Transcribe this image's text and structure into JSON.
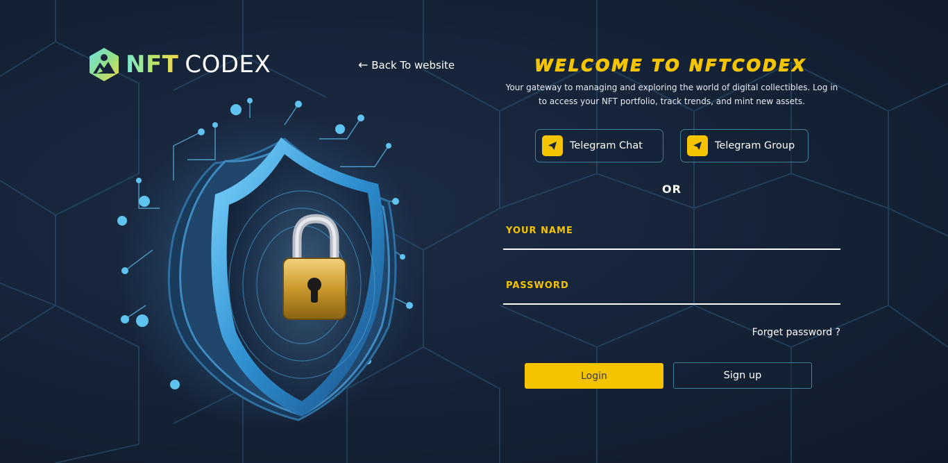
{
  "brand": {
    "name_part1": "NFT",
    "name_part2": "CODEX",
    "logo_icon": "mountain-hexagon-icon"
  },
  "nav": {
    "back_label": "Back To website",
    "back_icon": "arrow-left-icon"
  },
  "hero": {
    "illustration": "shield-padlock-illustration"
  },
  "form": {
    "heading": "WELCOME TO NFTCODEX",
    "subtitle": "Your gateway to managing and exploring the world of digital collectibles. Log in to access your NFT portfolio, track trends, and mint new assets.",
    "telegram_buttons": [
      {
        "label": "Telegram Chat",
        "icon": "telegram-icon"
      },
      {
        "label": "Telegram Group",
        "icon": "telegram-icon"
      }
    ],
    "or_text": "OR",
    "name_label": "YOUR NAME",
    "name_value": "",
    "password_label": "PASSWORD",
    "password_value": "",
    "forgot_label": "Forget password ?",
    "login_label": "Login",
    "signup_label": "Sign up"
  },
  "colors": {
    "background": "#17243a",
    "accent": "#f5c400",
    "border": "#3f7f98",
    "text": "#ffffff"
  }
}
